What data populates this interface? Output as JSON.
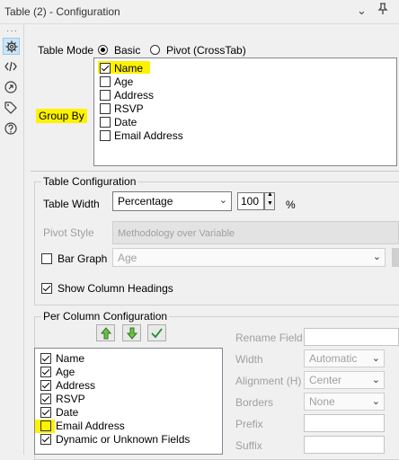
{
  "window": {
    "title": "Table (2) - Configuration"
  },
  "table_mode": {
    "label": "Table Mode",
    "options": [
      "Basic",
      "Pivot (CrossTab)"
    ],
    "selected": "Basic"
  },
  "group_by": {
    "label": "Group By",
    "fields": [
      {
        "name": "Name",
        "checked": true
      },
      {
        "name": "Age",
        "checked": false
      },
      {
        "name": "Address",
        "checked": false
      },
      {
        "name": "RSVP",
        "checked": false
      },
      {
        "name": "Date",
        "checked": false
      },
      {
        "name": "Email Address",
        "checked": false
      }
    ]
  },
  "table_config": {
    "title": "Table Configuration",
    "width_label": "Table Width",
    "width_mode": "Percentage",
    "width_value": "100",
    "width_unit": "%",
    "pivot_style_label": "Pivot Style",
    "pivot_style_value": "Methodology over Variable",
    "bar_graph_label": "Bar Graph",
    "bar_graph_checked": false,
    "bar_graph_field": "Age",
    "show_headings_label": "Show Column Headings",
    "show_headings_checked": true
  },
  "per_column": {
    "title": "Per Column Configuration",
    "fields": [
      {
        "name": "Name",
        "checked": true
      },
      {
        "name": "Age",
        "checked": true
      },
      {
        "name": "Address",
        "checked": true
      },
      {
        "name": "RSVP",
        "checked": true
      },
      {
        "name": "Date",
        "checked": true
      },
      {
        "name": "Email Address",
        "checked": false
      },
      {
        "name": "Dynamic or Unknown Fields",
        "checked": true
      }
    ],
    "rename_label": "Rename Field",
    "width_label": "Width",
    "width_value": "Automatic",
    "alignment_label": "Alignment (H)",
    "alignment_value": "Center",
    "borders_label": "Borders",
    "borders_value": "None",
    "prefix_label": "Prefix",
    "suffix_label": "Suffix"
  },
  "colors": {
    "highlight": "#fff200",
    "accent": "#007a33",
    "selection": "#cce4f7"
  }
}
